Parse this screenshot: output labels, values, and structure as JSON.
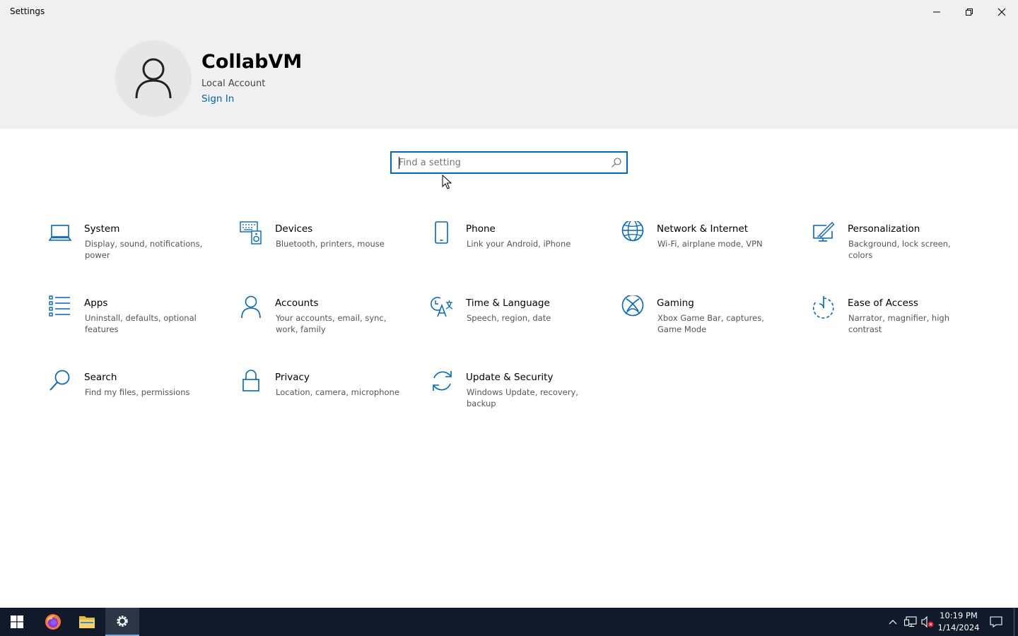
{
  "window": {
    "title": "Settings",
    "controls": {
      "minimize": "minimize-icon",
      "restore": "restore-icon",
      "close": "close-icon"
    }
  },
  "profile": {
    "username": "CollabVM",
    "account_type": "Local Account",
    "signin_label": "Sign In",
    "avatar_icon": "person-icon"
  },
  "search": {
    "placeholder": "Find a setting",
    "value": "",
    "icon": "search-icon"
  },
  "categories": [
    {
      "icon": "laptop-icon",
      "name": "System",
      "desc": "Display, sound, notifications, power"
    },
    {
      "icon": "keyboard-speaker-icon",
      "name": "Devices",
      "desc": "Bluetooth, printers, mouse"
    },
    {
      "icon": "phone-icon",
      "name": "Phone",
      "desc": "Link your Android, iPhone"
    },
    {
      "icon": "globe-icon",
      "name": "Network & Internet",
      "desc": "Wi-Fi, airplane mode, VPN"
    },
    {
      "icon": "paint-monitor-icon",
      "name": "Personalization",
      "desc": "Background, lock screen, colors"
    },
    {
      "icon": "apps-list-icon",
      "name": "Apps",
      "desc": "Uninstall, defaults, optional features"
    },
    {
      "icon": "person-icon",
      "name": "Accounts",
      "desc": "Your accounts, email, sync, work, family"
    },
    {
      "icon": "time-language-icon",
      "name": "Time & Language",
      "desc": "Speech, region, date"
    },
    {
      "icon": "xbox-icon",
      "name": "Gaming",
      "desc": "Xbox Game Bar, captures, Game Mode"
    },
    {
      "icon": "ease-of-access-icon",
      "name": "Ease of Access",
      "desc": "Narrator, magnifier, high contrast"
    },
    {
      "icon": "search-icon",
      "name": "Search",
      "desc": "Find my files, permissions"
    },
    {
      "icon": "lock-icon",
      "name": "Privacy",
      "desc": "Location, camera, microphone"
    },
    {
      "icon": "sync-arrows-icon",
      "name": "Update & Security",
      "desc": "Windows Update, recovery, backup"
    }
  ],
  "taskbar": {
    "apps": [
      "windows-start-icon",
      "firefox-icon",
      "file-explorer-icon",
      "settings-gear-icon"
    ],
    "active_app": "settings-gear-icon",
    "tray_icons": [
      "chevron-up-icon",
      "network-icon",
      "volume-muted-icon",
      "notification-icon"
    ],
    "time": "10:19 PM",
    "date": "1/14/2024"
  },
  "colors": {
    "accent": "#0067c0",
    "link": "#0066b4",
    "header_bg": "#f0f0f0",
    "taskbar_bg": "#101a2b"
  }
}
